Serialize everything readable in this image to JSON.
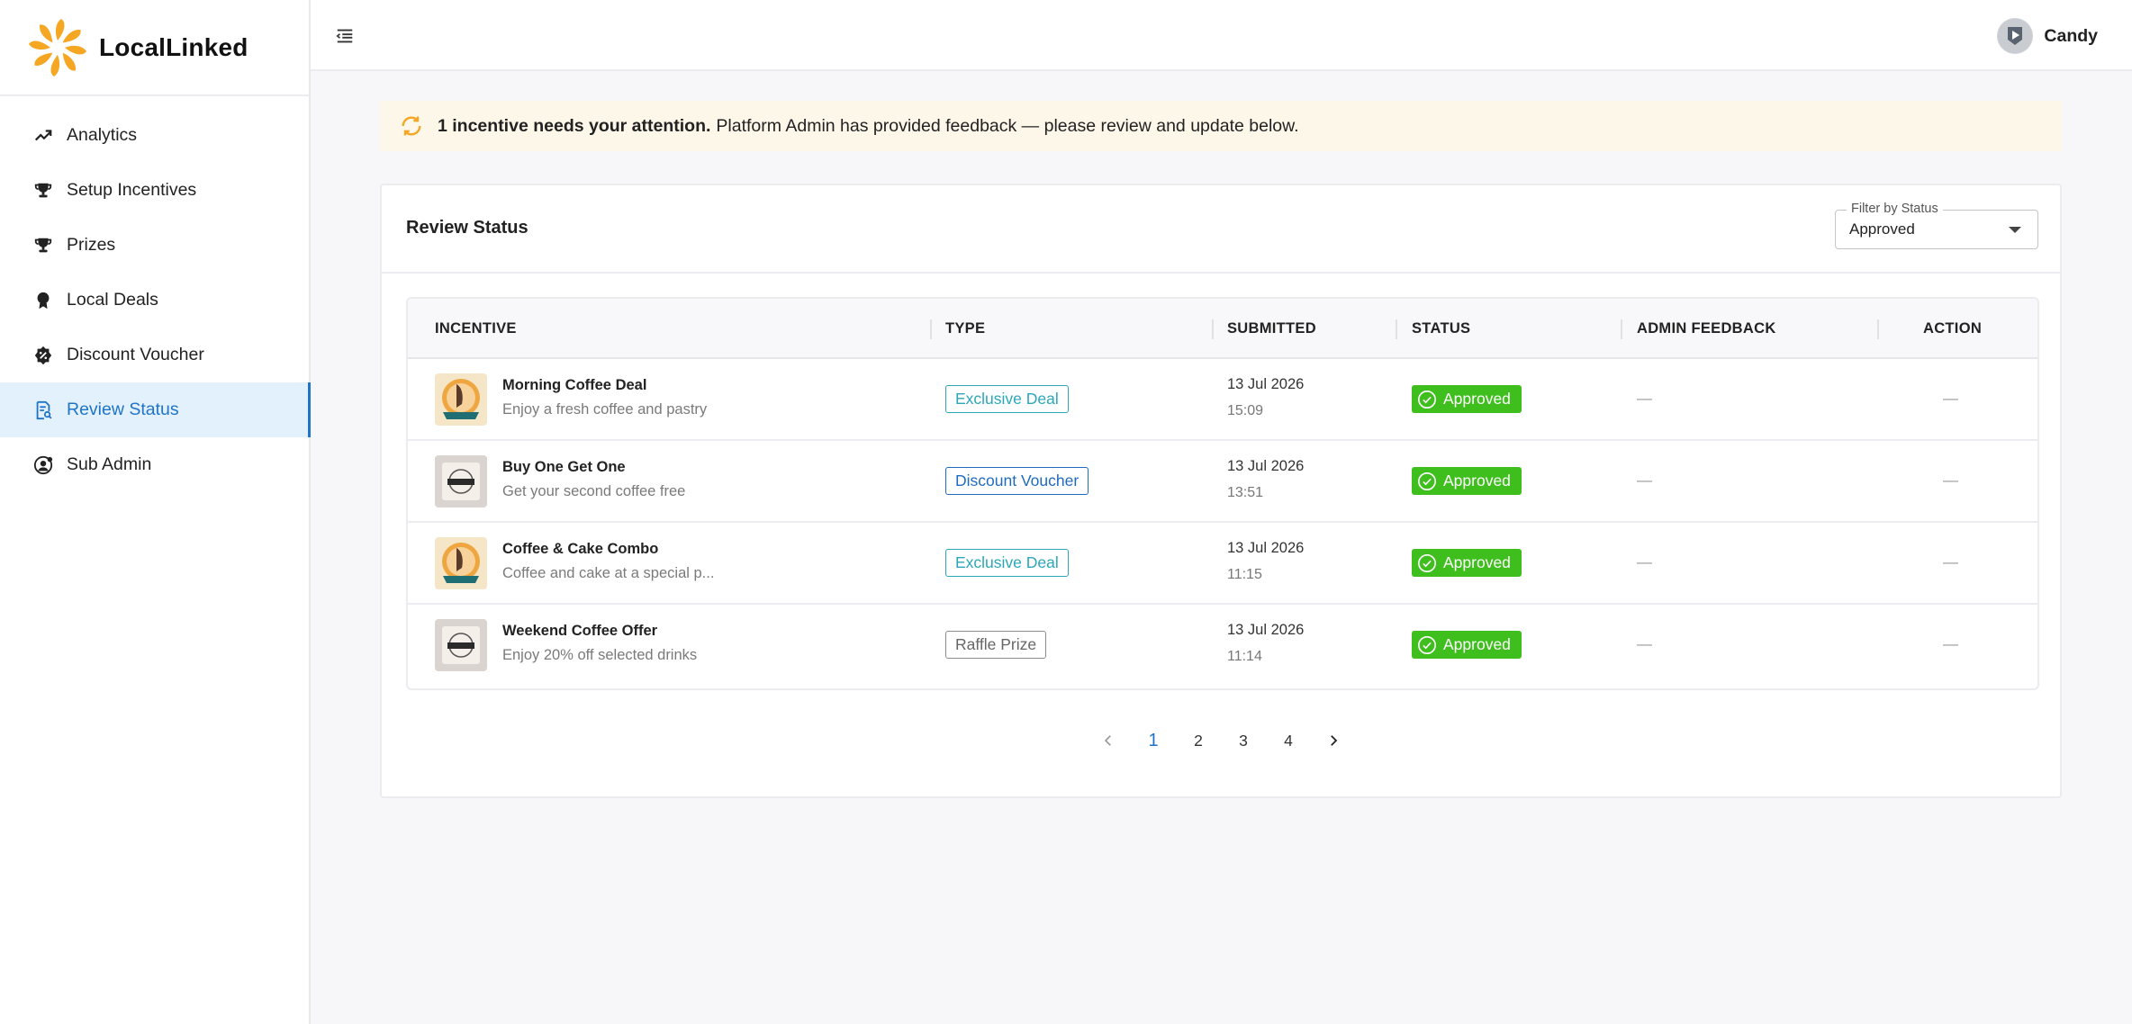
{
  "brand": {
    "name": "LocalLinked"
  },
  "sidebar": {
    "items": [
      {
        "label": "Analytics",
        "icon": "trending-up-icon",
        "active": false
      },
      {
        "label": "Setup Incentives",
        "icon": "trophy-icon",
        "active": false
      },
      {
        "label": "Prizes",
        "icon": "trophy-icon",
        "active": false
      },
      {
        "label": "Local Deals",
        "icon": "award-icon",
        "active": false
      },
      {
        "label": "Discount Voucher",
        "icon": "discount-badge-icon",
        "active": false
      },
      {
        "label": "Review Status",
        "icon": "review-document-icon",
        "active": true
      },
      {
        "label": "Sub Admin",
        "icon": "user-gear-icon",
        "active": false
      }
    ]
  },
  "topbar": {
    "user_name": "Candy"
  },
  "alert": {
    "bold": "1 incentive needs your attention.",
    "text": "Platform Admin has provided feedback — please review and update below."
  },
  "card": {
    "title": "Review Status",
    "filter": {
      "label": "Filter by Status",
      "value": "Approved"
    }
  },
  "table": {
    "headers": [
      "INCENTIVE",
      "TYPE",
      "SUBMITTED",
      "STATUS",
      "ADMIN FEEDBACK",
      "ACTION"
    ],
    "rows": [
      {
        "name": "Morning Coffee Deal",
        "desc": "Enjoy a fresh coffee and pastry",
        "type": "Exclusive Deal",
        "date": "13 Jul 2026",
        "time": "15:09",
        "status": "Approved",
        "feedback": "—",
        "action": "—"
      },
      {
        "name": "Buy One Get One",
        "desc": "Get your second coffee free",
        "type": "Discount Voucher",
        "date": "13 Jul 2026",
        "time": "13:51",
        "status": "Approved",
        "feedback": "—",
        "action": "—"
      },
      {
        "name": "Coffee & Cake Combo",
        "desc": "Coffee and cake at a special p...",
        "type": "Exclusive Deal",
        "date": "13 Jul 2026",
        "time": "11:15",
        "status": "Approved",
        "feedback": "—",
        "action": "—"
      },
      {
        "name": "Weekend Coffee Offer",
        "desc": "Enjoy 20% off selected drinks",
        "type": "Raffle Prize",
        "date": "13 Jul 2026",
        "time": "11:14",
        "status": "Approved",
        "feedback": "—",
        "action": "—"
      }
    ]
  },
  "pagination": {
    "pages": [
      "1",
      "2",
      "3",
      "4"
    ],
    "current": "1"
  },
  "colors": {
    "accent": "#1f74c8",
    "approved": "#3fbf1e",
    "brand_orange": "#f5a623",
    "alert_bg": "#fdf7ea"
  }
}
